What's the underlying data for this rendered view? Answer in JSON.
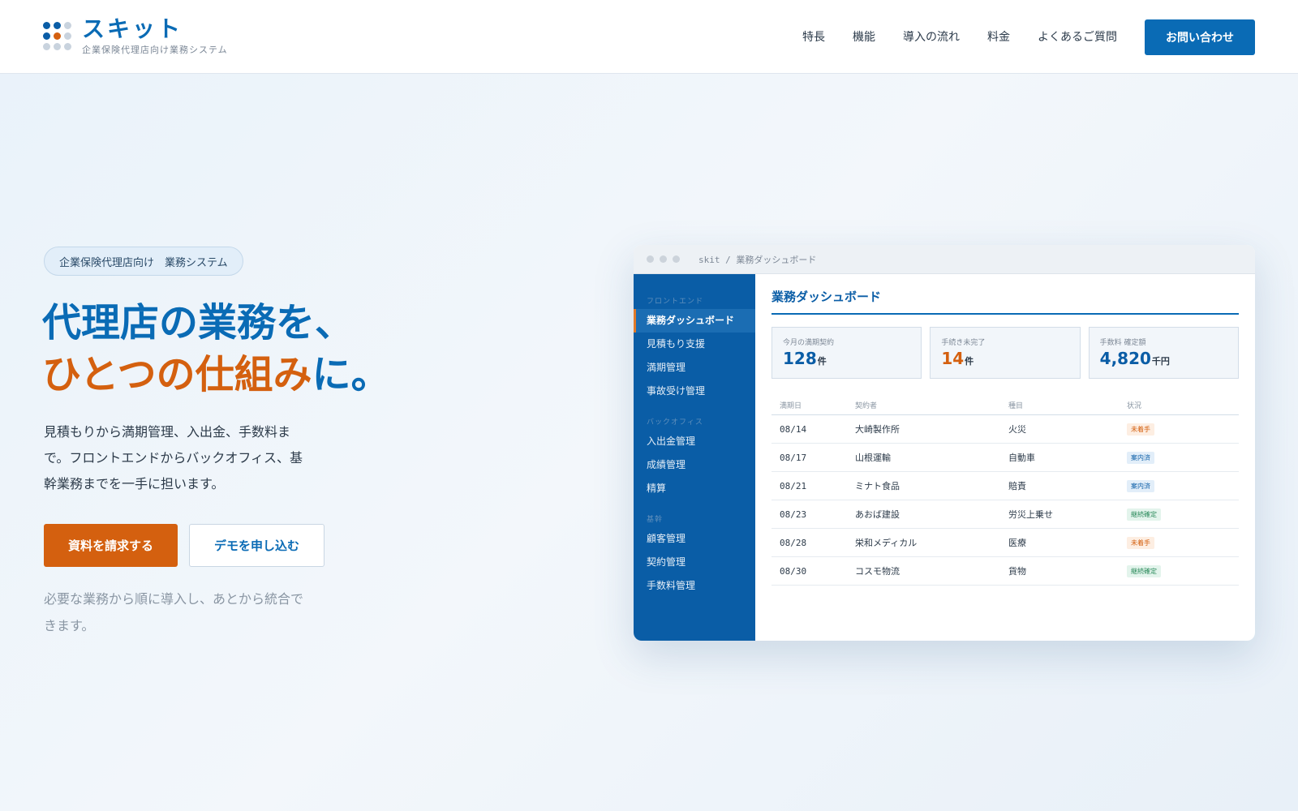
{
  "header": {
    "brand_name": "スキット",
    "brand_sub": "企業保険代理店向け業務システム",
    "nav": [
      "特長",
      "機能",
      "導入の流れ",
      "料金",
      "よくあるご質問"
    ],
    "contact_label": "お問い合わせ"
  },
  "hero": {
    "badge": "企業保険代理店向け　業務システム",
    "title_line1": "代理店の業務を、",
    "title_line2_orange": "ひとつの仕組み",
    "title_line2_blue": "に。",
    "desc": "見積もりから満期管理、入出金、手数料まで。フロントエンドからバックオフィス、基幹業務までを一手に担います。",
    "primary_label": "資料を請求する",
    "secondary_label": "デモを申し込む",
    "note": "必要な業務から順に導入し、あとから統合できます。"
  },
  "app": {
    "path": "skit / 業務ダッシュボード",
    "sections": [
      {
        "label": "フロントエンド",
        "items": [
          "業務ダッシュボード",
          "見積もり支援",
          "満期管理",
          "事故受け管理"
        ]
      },
      {
        "label": "バックオフィス",
        "items": [
          "入出金管理",
          "成績管理",
          "精算"
        ]
      },
      {
        "label": "基幹",
        "items": [
          "顧客管理",
          "契約管理",
          "手数料管理"
        ]
      }
    ],
    "active_item": "業務ダッシュボード",
    "title": "業務ダッシュボード",
    "stats": [
      {
        "label": "今月の満期契約",
        "value": "128",
        "unit": "件",
        "color": "#0a5da6"
      },
      {
        "label": "手続き未完了",
        "value": "14",
        "unit": "件",
        "color": "#d4600f"
      },
      {
        "label": "手数料 確定額",
        "value": "4,820",
        "unit": "千円",
        "color": "#0a5da6"
      }
    ],
    "table": {
      "headers": [
        "満期日",
        "契約者",
        "種目",
        "状況"
      ],
      "rows": [
        {
          "date": "08/14",
          "name": "大崎製作所",
          "type": "火災",
          "status": "未着手",
          "tone": "orange"
        },
        {
          "date": "08/17",
          "name": "山根運輸",
          "type": "自動車",
          "status": "案内済",
          "tone": "blue"
        },
        {
          "date": "08/21",
          "name": "ミナト食品",
          "type": "賠責",
          "status": "案内済",
          "tone": "blue"
        },
        {
          "date": "08/23",
          "name": "あおば建設",
          "type": "労災上乗せ",
          "status": "継続確定",
          "tone": "green"
        },
        {
          "date": "08/28",
          "name": "栄和メディカル",
          "type": "医療",
          "status": "未着手",
          "tone": "orange"
        },
        {
          "date": "08/30",
          "name": "コスモ物流",
          "type": "貨物",
          "status": "継続確定",
          "tone": "green"
        }
      ]
    }
  },
  "colors": {
    "primary": "#0a6bb5",
    "accent": "#d4600f",
    "sidebar": "#0a5da6"
  }
}
